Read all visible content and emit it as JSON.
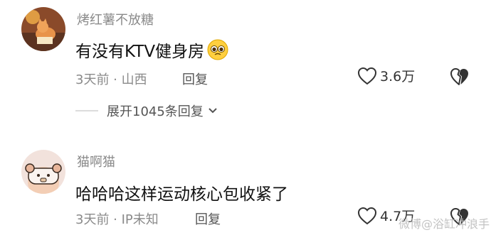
{
  "comments": [
    {
      "username": "烤红薯不放糖",
      "text": "有没有KTV健身房",
      "emoji": "pleading-face-emoji",
      "time": "3天前",
      "location": "山西",
      "reply_label": "回复",
      "likes": "3.6万",
      "expand_label": "展开1045条回复"
    },
    {
      "username": "猫啊猫",
      "text": "哈哈哈这样运动核心包收紧了",
      "time": "3天前",
      "location": "IP未知",
      "reply_label": "回复",
      "likes": "4.7万"
    }
  ],
  "meta_separator": " · ",
  "watermark": "微博@浴缸冲浪手",
  "icons": [
    "heart-icon",
    "broken-heart-icon",
    "chevron-down-icon"
  ],
  "colors": {
    "username": "#8a8a8a",
    "text": "#111111",
    "meta": "#8a8a8a",
    "reply": "#555555"
  }
}
